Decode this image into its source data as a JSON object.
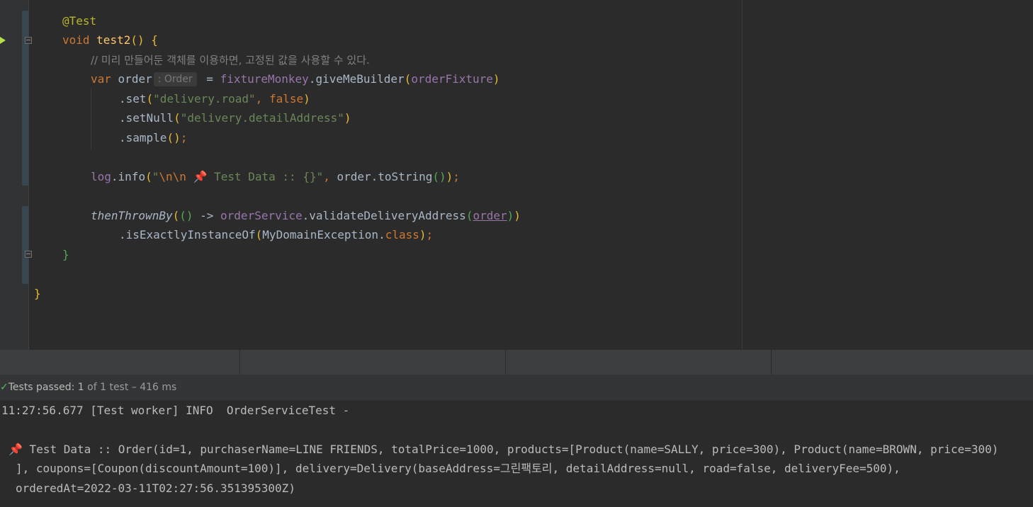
{
  "editor": {
    "lines": {
      "annotation": "@Test",
      "method_void": "void",
      "method_name": "test2",
      "comment": "// 미리 만들어둔 객체를 이용하면, 고정된 값을 사용할 수 있다.",
      "var_kw": "var",
      "var_name": "order",
      "type_hint": ": Order",
      "assign": " = ",
      "fixture_field": "fixtureMonkey",
      "builder_call": ".giveMeBuilder",
      "fixture_param": "orderFixture",
      "set_call": ".set",
      "set_arg": "\"delivery.road\"",
      "set_false": "false",
      "setnull_call": ".setNull",
      "setnull_arg": "\"delivery.detailAddress\"",
      "sample_call": ".sample",
      "log_field": "log",
      "log_call": ".info",
      "log_str_open": "\"",
      "log_escape": "\\n\\n",
      "log_str_body": " Test Data :: {}\"",
      "log_order": "order",
      "tostring_call": ".toString",
      "thrown_call": "thenThrownBy",
      "arrow": " -> ",
      "service_field": "orderService",
      "validate_call": ".validateDeliveryAddress",
      "validate_arg": "order",
      "instance_call": ".isExactlyInstanceOf",
      "exception_class": "MyDomainException",
      "class_kw": "class"
    }
  },
  "test_runner": {
    "status_label": "Tests passed:",
    "passed_count": "1",
    "of_total": "of 1 test",
    "duration": "– 416 ms"
  },
  "console": {
    "line1": "11:27:56.677 [Test worker] INFO  OrderServiceTest -",
    "line2": " Test Data :: Order(id=1, purchaserName=LINE FRIENDS, totalPrice=1000, products=[Product(name=SALLY, price=300), Product(name=BROWN, price=300)",
    "line3": "], coupons=[Coupon(discountAmount=100)], delivery=Delivery(baseAddress=그린팩토리, detailAddress=null, road=false, deliveryFee=500),",
    "line4": "orderedAt=2022-03-11T02:27:56.351395300Z)"
  },
  "icons": {
    "run": "run-test-icon",
    "fold": "fold-icon",
    "pin": "pushpin-icon",
    "check": "check-icon"
  },
  "colors": {
    "editor_bg": "#2b2b2b",
    "annotation": "#bbb529",
    "keyword": "#cc7832",
    "method": "#ffc66d",
    "field": "#9876aa",
    "string": "#6a8759"
  }
}
